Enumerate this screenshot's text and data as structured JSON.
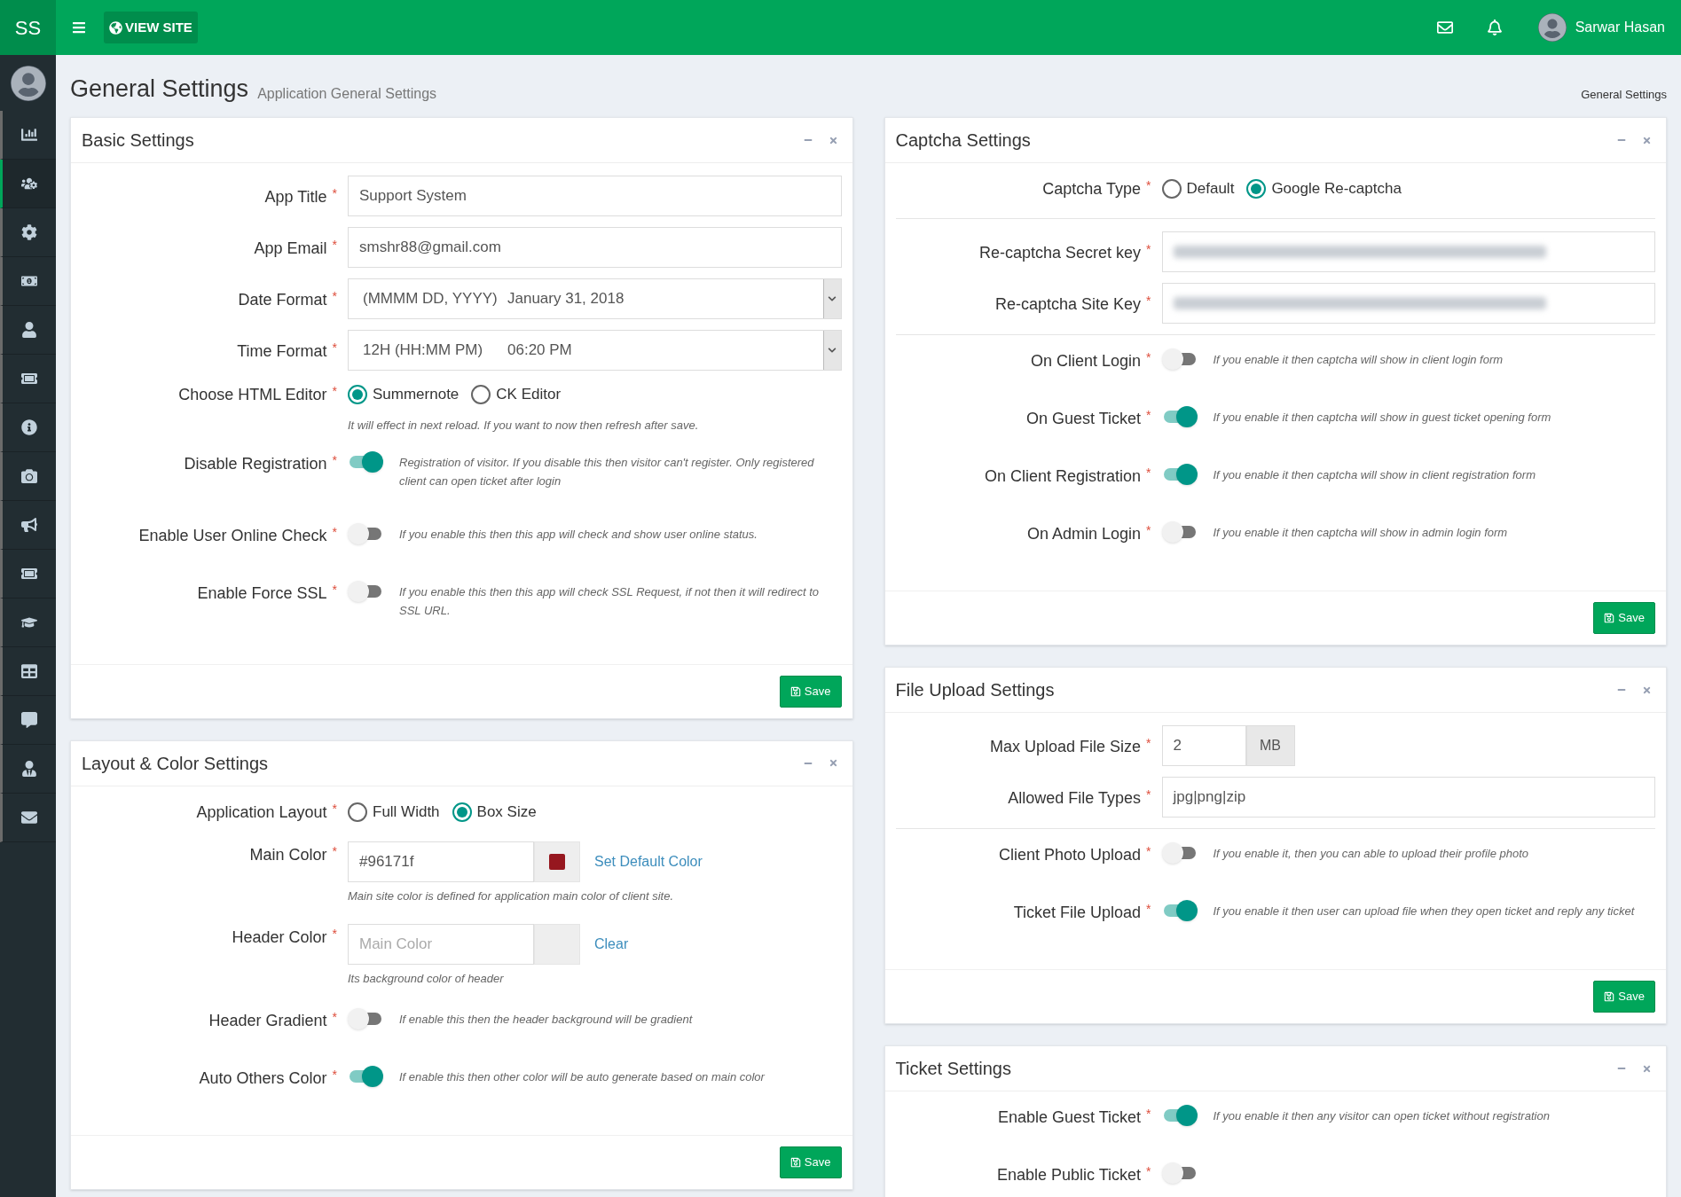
{
  "topbar": {
    "logo": "SS",
    "view_site": "VIEW SITE",
    "user_name": "Sarwar Hasan"
  },
  "sidebar": {
    "items": [
      {
        "selected": false
      },
      {
        "selected": true
      },
      {
        "selected": false
      },
      {
        "selected": false
      },
      {
        "selected": false
      },
      {
        "selected": false
      },
      {
        "selected": false
      },
      {
        "selected": false
      },
      {
        "selected": false
      },
      {
        "selected": false
      },
      {
        "selected": false
      },
      {
        "selected": false
      },
      {
        "selected": false
      },
      {
        "selected": false
      },
      {
        "selected": false
      }
    ]
  },
  "page": {
    "title": "General Settings",
    "subtitle": "Application General Settings",
    "breadcrumb": "General Settings"
  },
  "left_column": [
    {
      "title": "Basic Settings",
      "save": "Save",
      "rows": [
        {
          "kind": "text",
          "label": "App Title",
          "mark": "*",
          "value": "Support System"
        },
        {
          "kind": "text",
          "label": "App Email",
          "mark": "*",
          "value": "smshr88@gmail.com"
        },
        {
          "kind": "select",
          "label": "Date Format",
          "mark": "*",
          "format": "(MMMM DD, YYYY)",
          "example": "January 31, 2018"
        },
        {
          "kind": "select",
          "label": "Time Format",
          "mark": "*",
          "format": "12H (HH:MM PM)",
          "example": "06:20 PM"
        },
        {
          "kind": "radio",
          "label": "Choose HTML Editor",
          "mark": "*",
          "options": [
            {
              "label": "Summernote",
              "selected": true
            },
            {
              "label": "CK Editor",
              "selected": false
            }
          ],
          "note": "It will effect in next reload. If you want to now then refresh after save."
        },
        {
          "kind": "toggle",
          "label": "Disable Registration",
          "mark": "*",
          "on": true,
          "help": "Registration of visitor. If you disable this then visitor can't register. Only registered client can open ticket after login"
        },
        {
          "kind": "toggle",
          "label": "Enable User Online Check",
          "mark": "*",
          "on": false,
          "help": "If you enable this then this app will check and show user online status."
        },
        {
          "kind": "toggle",
          "label": "Enable Force SSL",
          "mark": "*",
          "on": false,
          "help": "If you enable this then this app will check SSL Request, if not then it will redirect to SSL URL."
        }
      ]
    },
    {
      "title": "Layout & Color Settings",
      "save": "Save",
      "rows": [
        {
          "kind": "radio",
          "label": "Application Layout",
          "mark": "*",
          "options": [
            {
              "label": "Full Width",
              "selected": false
            },
            {
              "label": "Box Size",
              "selected": true
            }
          ]
        },
        {
          "kind": "color",
          "label": "Main Color",
          "mark": "*",
          "value": "#96171f",
          "link": "Set Default Color",
          "note": "Main site color is defined for application main color of client site."
        },
        {
          "kind": "color",
          "label": "Header Color",
          "mark": "*",
          "placeholder": "Main Color",
          "link": "Clear",
          "note": "Its background color of header"
        },
        {
          "kind": "toggle",
          "label": "Header Gradient",
          "mark": "*",
          "on": false,
          "help": "If enable this then the header background will be gradient"
        },
        {
          "kind": "toggle",
          "label": "Auto Others Color",
          "mark": "*",
          "on": true,
          "help": "If enable this then other color will be auto generate based on main color"
        }
      ]
    }
  ],
  "right_column": [
    {
      "title": "Captcha Settings",
      "save": "Save",
      "rows": [
        {
          "kind": "radio",
          "label": "Captcha Type",
          "mark": "*",
          "options": [
            {
              "label": "Default",
              "selected": false
            },
            {
              "label": "Google Re-captcha",
              "selected": true
            }
          ]
        },
        {
          "kind": "divider"
        },
        {
          "kind": "secret",
          "label": "Re-captcha Secret key",
          "mark": "*"
        },
        {
          "kind": "secret",
          "label": "Re-captcha Site Key",
          "mark": "*"
        },
        {
          "kind": "divider"
        },
        {
          "kind": "toggle",
          "label": "On Client Login",
          "mark": "*",
          "on": false,
          "help": "If you enable it then captcha will show in client login form"
        },
        {
          "kind": "toggle",
          "label": "On Guest Ticket",
          "mark": "*",
          "on": true,
          "help": "If you enable it then captcha will show in guest ticket opening form"
        },
        {
          "kind": "toggle",
          "label": "On Client Registration",
          "mark": "*",
          "on": true,
          "help": "If you enable it then captcha will show in client registration form"
        },
        {
          "kind": "toggle",
          "label": "On Admin Login",
          "mark": "*",
          "on": false,
          "help": "If you enable it then captcha will show in admin login form"
        }
      ]
    },
    {
      "title": "File Upload Settings",
      "save": "Save",
      "rows": [
        {
          "kind": "addon",
          "label": "Max Upload File Size",
          "mark": "*",
          "value": "2",
          "addon": "MB"
        },
        {
          "kind": "text",
          "label": "Allowed File Types",
          "mark": "*",
          "value": "jpg|png|zip"
        },
        {
          "kind": "divider"
        },
        {
          "kind": "toggle",
          "label": "Client Photo Upload",
          "mark": "*",
          "on": false,
          "help": "If you enable it, then you can able to upload their profile photo"
        },
        {
          "kind": "toggle",
          "label": "Ticket File Upload",
          "mark": "*",
          "on": true,
          "help": "If you enable it then user can upload file when they open ticket and reply any ticket"
        }
      ]
    },
    {
      "title": "Ticket Settings",
      "rows": [
        {
          "kind": "toggle",
          "label": "Enable Guest Ticket",
          "mark": "*",
          "on": true,
          "help": "If you enable it then any visitor can open ticket without registration"
        },
        {
          "kind": "toggle",
          "label": "Enable Public Ticket",
          "mark": "*",
          "on": false
        }
      ]
    }
  ]
}
